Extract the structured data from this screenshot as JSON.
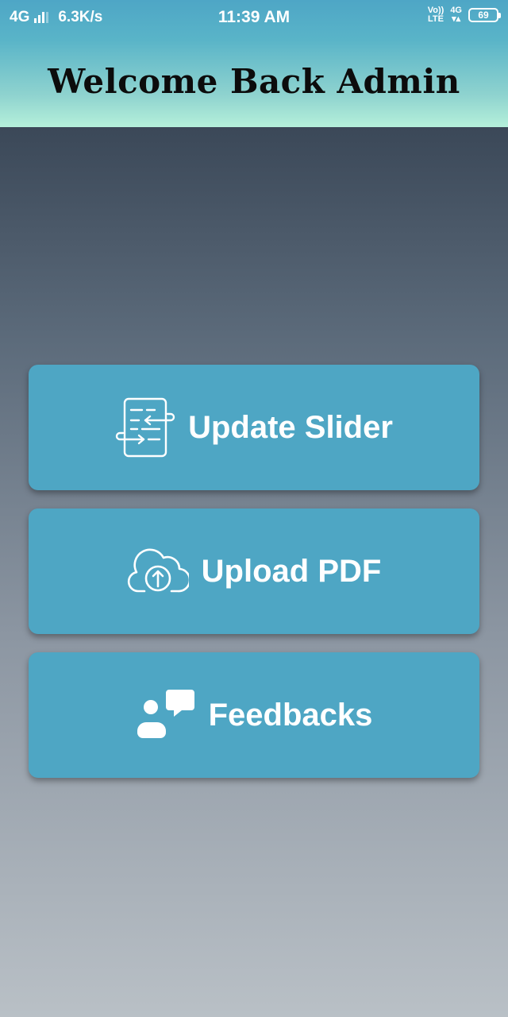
{
  "status_bar": {
    "network": "4G",
    "speed": "6.3K/s",
    "time": "11:39 AM",
    "volte_line1": "Vo))",
    "volte_line2": "LTE",
    "network_right": "4G",
    "battery": "69"
  },
  "header": {
    "title": "Welcome Back Admin"
  },
  "actions": [
    {
      "label": "Update Slider",
      "icon": "document-transfer-icon"
    },
    {
      "label": "Upload PDF",
      "icon": "cloud-upload-icon"
    },
    {
      "label": "Feedbacks",
      "icon": "user-chat-icon"
    }
  ],
  "colors": {
    "header_top": "#4ea6c6",
    "header_bottom": "#b5f0da",
    "card": "#4ea6c4",
    "title_text": "#0c0c0c",
    "card_text": "#ffffff"
  }
}
